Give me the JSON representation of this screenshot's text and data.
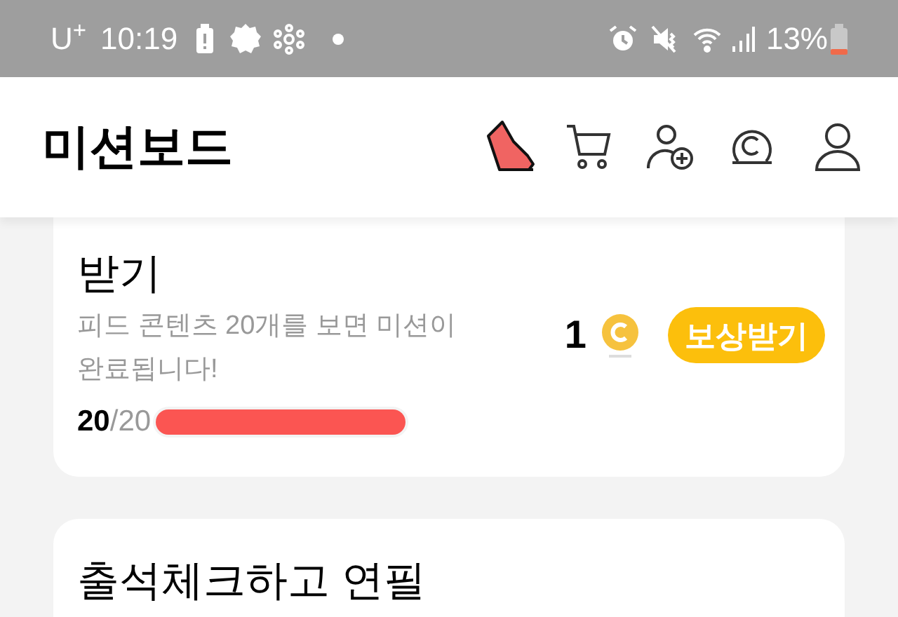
{
  "status_bar": {
    "carrier": "U$^{+}$",
    "time": "10:19",
    "battery": "13%"
  },
  "header": {
    "title": "미션보드"
  },
  "missions": [
    {
      "title": "받기",
      "description": "피드 콘텐츠 20개를 보면 미션이 완료됩니다!",
      "progress_done": "20",
      "progress_total": "/20",
      "level": 1,
      "reward": "1",
      "button": "보상받기"
    },
    {
      "title": "출석체크하고 연필"
    }
  ]
}
